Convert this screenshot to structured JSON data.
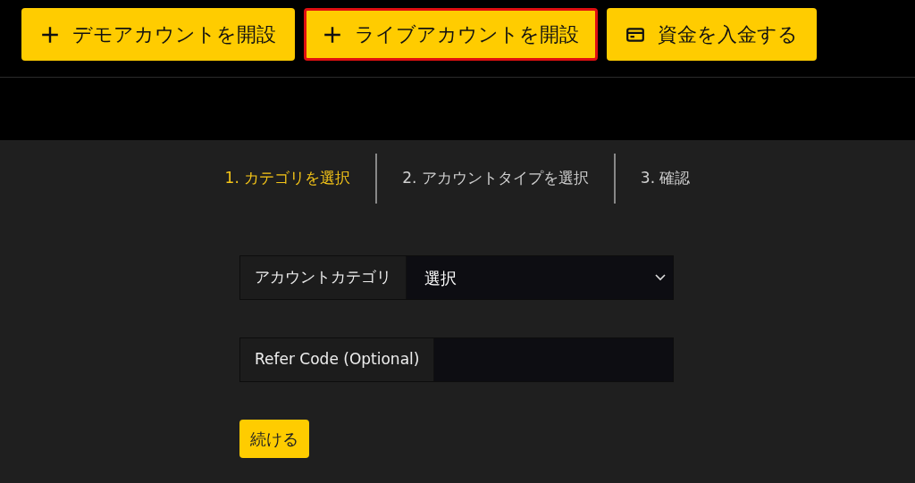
{
  "top_buttons": [
    {
      "label": "デモアカウントを開設",
      "kind": "open",
      "highlighted": false
    },
    {
      "label": "ライブアカウントを開設",
      "kind": "open",
      "highlighted": true
    },
    {
      "label": "資金を入金する",
      "kind": "deposit",
      "highlighted": false
    }
  ],
  "steps": [
    {
      "label": "1. カテゴリを選択",
      "selected": true
    },
    {
      "label": "2. アカウントタイプを選択",
      "selected": false
    },
    {
      "label": "3. 確認",
      "selected": false
    }
  ],
  "form": {
    "fields": [
      {
        "kind": "select",
        "label": "アカウントカテゴリ",
        "value": "選択"
      },
      {
        "kind": "text",
        "label": "Refer Code (Optional)"
      }
    ],
    "submit": "続ける"
  }
}
